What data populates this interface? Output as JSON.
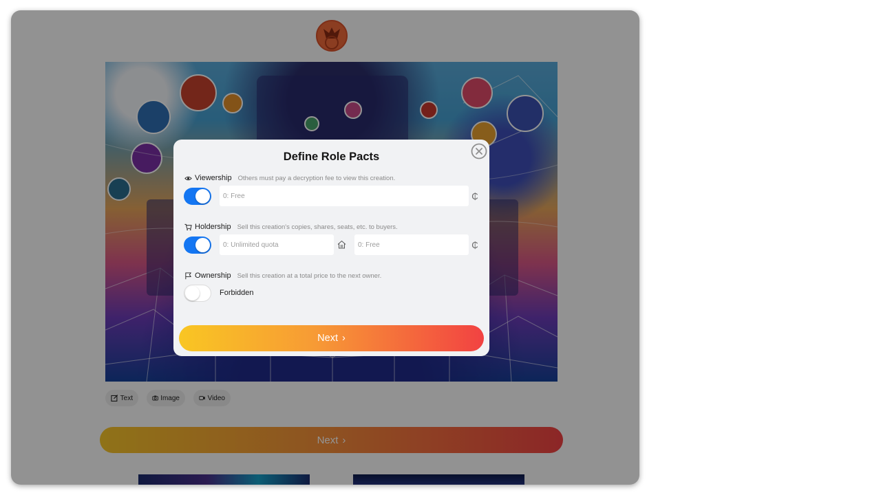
{
  "page": {
    "attach": {
      "text_label": "Text",
      "image_label": "Image",
      "video_label": "Video"
    },
    "next_label": "Next"
  },
  "modal": {
    "title": "Define Role Pacts",
    "viewership": {
      "label": "Viewership",
      "description": "Others must pay a decryption fee to view this creation.",
      "enabled": true,
      "price_placeholder": "0: Free",
      "unit": "₵"
    },
    "holdership": {
      "label": "Holdership",
      "description": "Sell this creation's copies, shares, seats, etc. to buyers.",
      "enabled": true,
      "quota_placeholder": "0: Unlimited quota",
      "price_placeholder": "0: Free",
      "unit": "₵"
    },
    "ownership": {
      "label": "Ownership",
      "description": "Sell this creation at a total price to the next owner.",
      "enabled": false,
      "status": "Forbidden"
    },
    "next_label": "Next"
  },
  "colors": {
    "accent_blue": "#1476f2",
    "gradient_start": "#f9c623",
    "gradient_end": "#f24242"
  }
}
